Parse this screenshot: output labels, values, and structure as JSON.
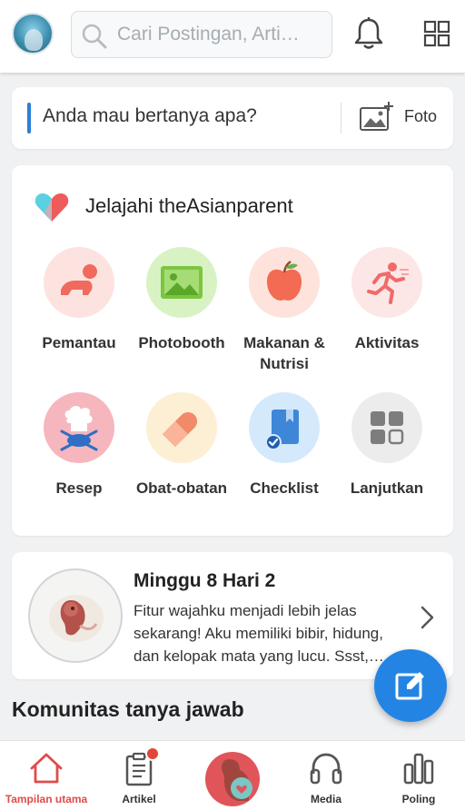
{
  "header": {
    "search_placeholder": "Cari Postingan, Arti…"
  },
  "ask": {
    "question": "Anda mau bertanya apa?",
    "photo_label": "Foto"
  },
  "explore": {
    "title": "Jelajahi theAsianparent",
    "items": [
      {
        "label": "Pemantau",
        "icon": "baby-crawl-icon",
        "color": "#fde3e0"
      },
      {
        "label": "Photobooth",
        "icon": "image-icon",
        "color": "#d8f2c4"
      },
      {
        "label": "Makanan & Nutrisi",
        "icon": "apple-icon",
        "color": "#fde3dc"
      },
      {
        "label": "Aktivitas",
        "icon": "running-icon",
        "color": "#fde6e6"
      },
      {
        "label": "Resep",
        "icon": "chef-icon",
        "color": "#f6b6bd"
      },
      {
        "label": "Obat-obatan",
        "icon": "pill-icon",
        "color": "#fdefd3"
      },
      {
        "label": "Checklist",
        "icon": "checklist-icon",
        "color": "#d4e9fb"
      },
      {
        "label": "Lanjutkan",
        "icon": "grid-icon",
        "color": "#ececec"
      }
    ]
  },
  "pregnancy": {
    "title": "Minggu 8 Hari 2",
    "description": "Fitur wajahku menjadi lebih jelas sekarang! Aku memiliki bibir, hidung, dan kelopak mata yang lucu. Ssst,…"
  },
  "section": {
    "title": "Komunitas tanya jawab"
  },
  "bottom_nav": {
    "home": "Tampilan utama",
    "articles": "Artikel",
    "media": "Media",
    "poll": "Poling"
  },
  "colors": {
    "accent_blue": "#2484e3",
    "active_red": "#e04b4b"
  }
}
